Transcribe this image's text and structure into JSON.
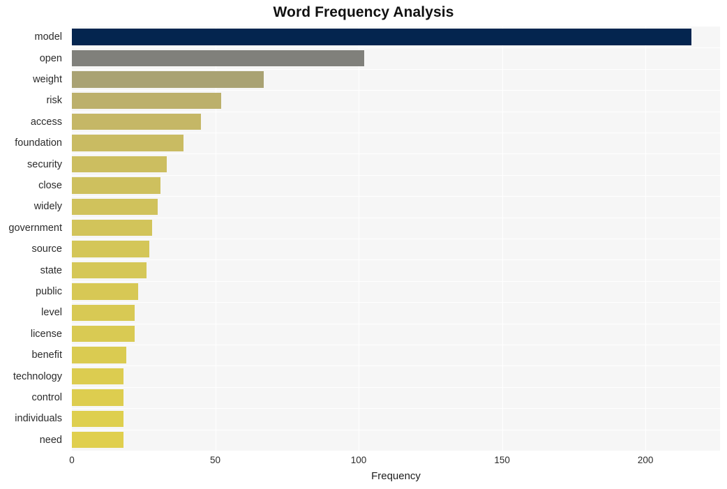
{
  "chart_data": {
    "type": "bar",
    "orientation": "horizontal",
    "title": "Word Frequency Analysis",
    "xlabel": "Frequency",
    "ylabel": "",
    "xlim": [
      0,
      226
    ],
    "xticks": [
      0,
      50,
      100,
      150,
      200
    ],
    "xtick_labels": [
      "0",
      "50",
      "100",
      "150",
      "200"
    ],
    "grid": true,
    "legend": null,
    "categories": [
      "model",
      "open",
      "weight",
      "risk",
      "access",
      "foundation",
      "security",
      "close",
      "widely",
      "government",
      "source",
      "state",
      "public",
      "level",
      "license",
      "benefit",
      "technology",
      "control",
      "individuals",
      "need"
    ],
    "values": [
      216,
      102,
      67,
      52,
      45,
      39,
      33,
      31,
      30,
      28,
      27,
      26,
      23,
      22,
      22,
      19,
      18,
      18,
      18,
      18
    ],
    "bar_colors": [
      "#04254f",
      "#80807b",
      "#a9a273",
      "#bcb06b",
      "#c5b766",
      "#c9bb62",
      "#ccbe60",
      "#cec05e",
      "#d0c25c",
      "#d2c45a",
      "#d4c658",
      "#d5c757",
      "#d7c855",
      "#d8c954",
      "#d9ca53",
      "#dacb51",
      "#dccc50",
      "#ddcd4f",
      "#decf4e",
      "#e0cf4e"
    ]
  },
  "style": {
    "plot_background": "#f6f6f6",
    "page_background": "#ffffff",
    "gridline_color": "#ffffff",
    "title_color": "#111111",
    "tick_color": "#2b2b2b"
  }
}
